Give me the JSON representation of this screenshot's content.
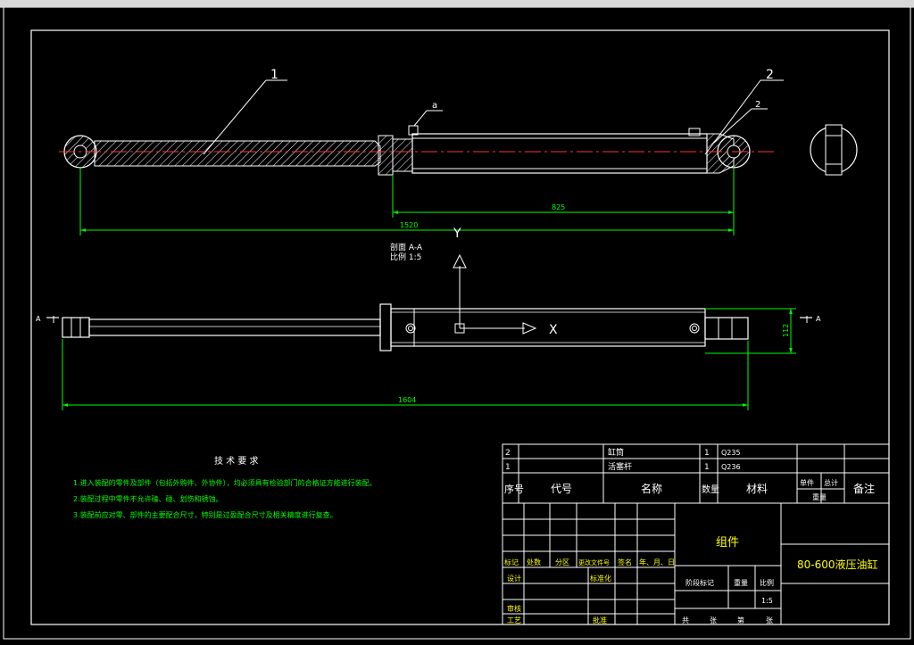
{
  "drawing": {
    "leader_1": "1",
    "leader_2": "2",
    "leader_2b": "2",
    "leader_a": "a",
    "dim_total": "1520",
    "dim_stroke": "825",
    "dim_section_total": "1604",
    "dim_height": "112",
    "section_title": "剖面 A-A",
    "section_scale": "比例 1:5",
    "axis_y": "Y",
    "axis_x": "X",
    "section_mark_left": "A",
    "section_mark_right": "A"
  },
  "tech_requirements": {
    "title": "技 术 要 求",
    "items": [
      "1.进入装配的零件及部件（包括外购件、外协件），均必须具有检验部门的合格证方能进行装配。",
      "2.装配过程中零件不允许磕、碰、划伤和锈蚀。",
      "3.装配前应对零、部件的主要配合尺寸，特别是过盈配合尺寸及相关精度进行复查。"
    ]
  },
  "bom": {
    "rows": [
      {
        "no": "2",
        "code": "",
        "name": "缸筒",
        "qty": "1",
        "material": "Q235"
      },
      {
        "no": "1",
        "code": "",
        "name": "活塞杆",
        "qty": "1",
        "material": "Q236"
      }
    ],
    "header": {
      "no": "序号",
      "code": "代号",
      "name": "名称",
      "qty": "数量",
      "material": "材料",
      "unit": "单件",
      "total": "总计",
      "weight": "重量",
      "remark": "备注"
    }
  },
  "title_block": {
    "assembly": "组件",
    "drawing_title": "80-600液压油缸",
    "rev_labels": [
      "标记",
      "处数",
      "分区",
      "更改文件号",
      "签名",
      "年、月、日"
    ],
    "design": "设计",
    "standardization": "标准化",
    "stage_mark": "阶段标记",
    "weight": "重量",
    "scale": "比例",
    "scale_value": "1:5",
    "review": "审核",
    "process": "工艺",
    "approve": "批准",
    "sheets": [
      "共",
      "张",
      "第",
      "张"
    ]
  }
}
